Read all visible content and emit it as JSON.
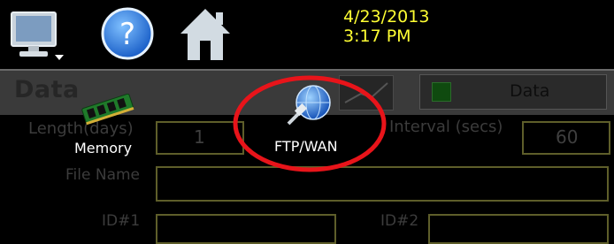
{
  "header": {
    "date": "4/23/2013",
    "time": "3:17 PM"
  },
  "page": {
    "title": "Data",
    "status_label": "Data"
  },
  "form": {
    "length_label": "Length(days)",
    "length_value": "1",
    "interval_label": "Interval (secs)",
    "interval_value": "60",
    "file_name_label": "File Name",
    "file_name_value": "",
    "id1_label": "ID#1",
    "id2_label": "ID#2"
  },
  "popup_menu": {
    "memory_label": "Memory",
    "ftp_label": "FTP/WAN",
    "highlight_color": "#e8141a"
  },
  "colors": {
    "datetime": "#ffff33",
    "field_border": "#5e5e2a",
    "background": "#000000"
  },
  "icons": {
    "monitor": "monitor-icon",
    "help": "help-icon",
    "home": "home-icon",
    "memory": "memory-chip-icon",
    "ftp": "network-globe-icon"
  }
}
